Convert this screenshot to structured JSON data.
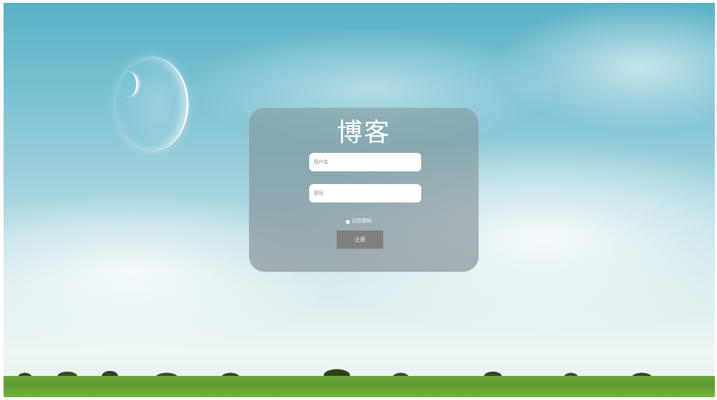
{
  "login": {
    "title": "博客",
    "username_placeholder": "用户名",
    "password_placeholder": "密码",
    "remember_label": "记住密码",
    "submit_label": "注册"
  }
}
